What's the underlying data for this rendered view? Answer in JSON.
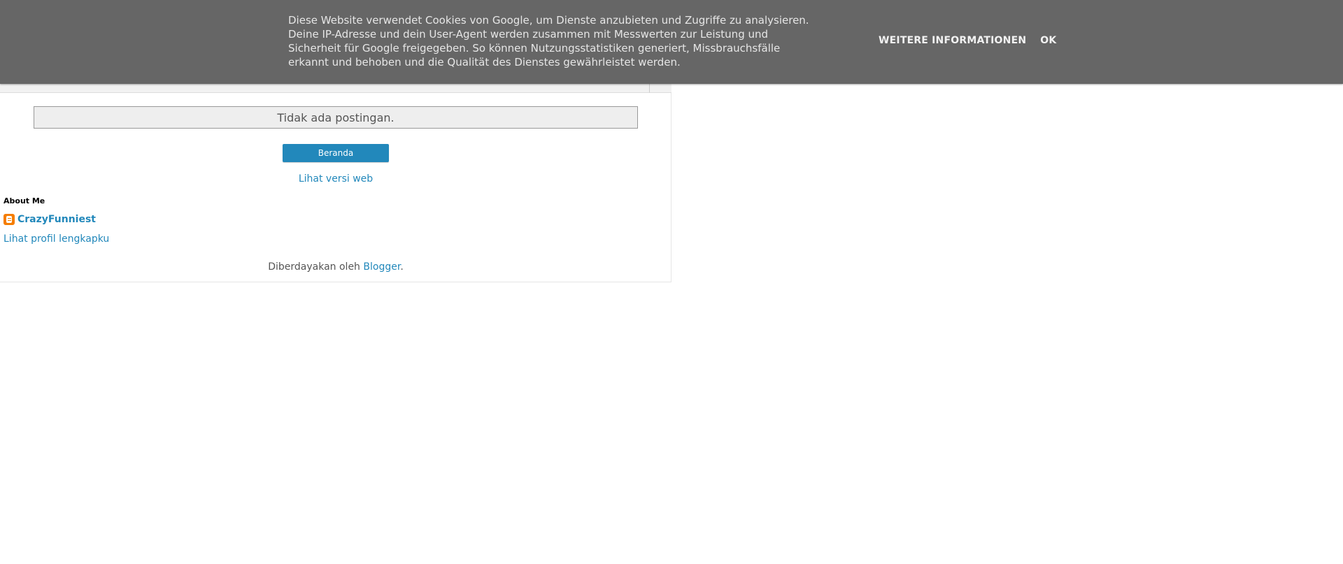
{
  "cookie_banner": {
    "message_lines": [
      "Diese Website verwendet Cookies von Google, um Dienste anzubieten und Zugriffe zu analysieren.",
      "Deine IP-Adresse und dein User-Agent werden zusammen mit Messwerten zur Leistung und",
      "Sicherheit für Google freigegeben. So können Nutzungsstatistiken generiert, Missbrauchsfälle",
      "erkannt und behoben und die Qualität des Dienstes gewährleistet werden."
    ],
    "more_info_label": "WEITERE INFORMATIONEN",
    "ok_label": "OK"
  },
  "main": {
    "no_posts_text": "Tidak ada postingan.",
    "home_button_label": "Beranda",
    "web_version_label": "Lihat versi web"
  },
  "about": {
    "title": "About Me",
    "profile_name": "CrazyFunniest",
    "full_profile_label": "Lihat profil lengkapku",
    "profile_icon": "blogger-icon"
  },
  "footer": {
    "powered_by_prefix": "Diberdayakan oleh ",
    "powered_by_link": "Blogger",
    "powered_by_suffix": "."
  },
  "colors": {
    "banner_bg": "#666666",
    "link": "#2288bb",
    "button_bg": "#2288bb",
    "blogger_orange": "#f57d00"
  }
}
